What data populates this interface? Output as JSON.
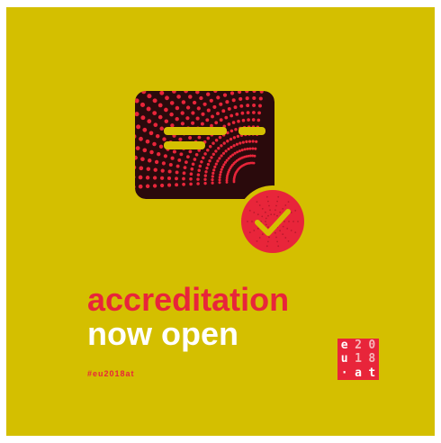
{
  "headline": {
    "line1": "accreditation",
    "line2": "now open"
  },
  "hashtag": "#eu2018at",
  "logo": {
    "cells": [
      "e",
      "2",
      "0",
      "u",
      "1",
      "8",
      "·",
      "a",
      "t"
    ]
  },
  "colors": {
    "background": "#d4bf00",
    "accent": "#e8253a",
    "text_light": "#ffffff"
  },
  "icons": {
    "card": "accreditation-card-icon",
    "check": "checkmark-badge-icon"
  }
}
